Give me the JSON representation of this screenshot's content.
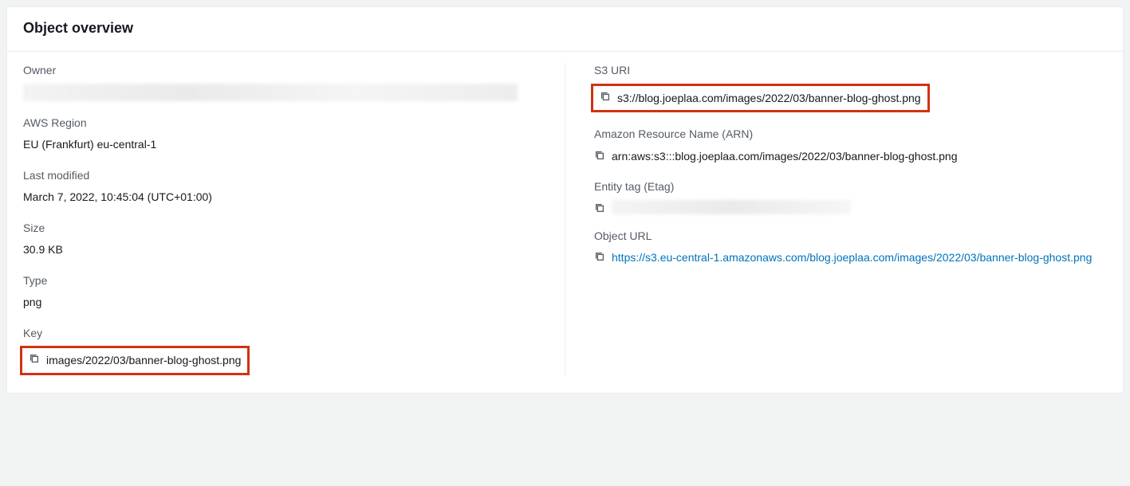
{
  "header": {
    "title": "Object overview"
  },
  "left": {
    "owner": {
      "label": "Owner"
    },
    "region": {
      "label": "AWS Region",
      "value": "EU (Frankfurt) eu-central-1"
    },
    "lastModified": {
      "label": "Last modified",
      "value": "March 7, 2022, 10:45:04 (UTC+01:00)"
    },
    "size": {
      "label": "Size",
      "value": "30.9 KB"
    },
    "type": {
      "label": "Type",
      "value": "png"
    },
    "key": {
      "label": "Key",
      "value": "images/2022/03/banner-blog-ghost.png"
    }
  },
  "right": {
    "s3uri": {
      "label": "S3 URI",
      "value": "s3://blog.joeplaa.com/images/2022/03/banner-blog-ghost.png"
    },
    "arn": {
      "label": "Amazon Resource Name (ARN)",
      "value": "arn:aws:s3:::blog.joeplaa.com/images/2022/03/banner-blog-ghost.png"
    },
    "etag": {
      "label": "Entity tag (Etag)"
    },
    "objectUrl": {
      "label": "Object URL",
      "value": "https://s3.eu-central-1.amazonaws.com/blog.joeplaa.com/images/2022/03/banner-blog-ghost.png"
    }
  }
}
